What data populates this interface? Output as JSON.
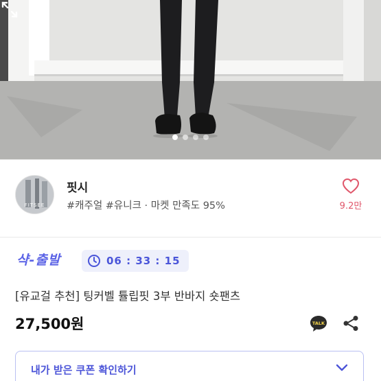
{
  "hero": {
    "image_desc_icon": "product-photo",
    "slide_count": 4,
    "active_slide": 1
  },
  "shop": {
    "avatar_text": "FITSEE",
    "name": "핏시",
    "tags": "#캐주얼 #유니크 · 마켓 만족도 95%",
    "like_count": "9.2만"
  },
  "product": {
    "event_label": "샥-출발",
    "timer": "06 : 33 : 15",
    "title": "[유교걸 추천] 팅커벨 튤립핏 3부 반바지 숏팬츠",
    "price": "27,500원",
    "talk_label": "TALK"
  },
  "coupon": {
    "label": "내가 받은 쿠폰 확인하기"
  },
  "colors": {
    "accent": "#5b63e6",
    "like": "#e0566a",
    "timer_bg": "#eef0fb"
  }
}
